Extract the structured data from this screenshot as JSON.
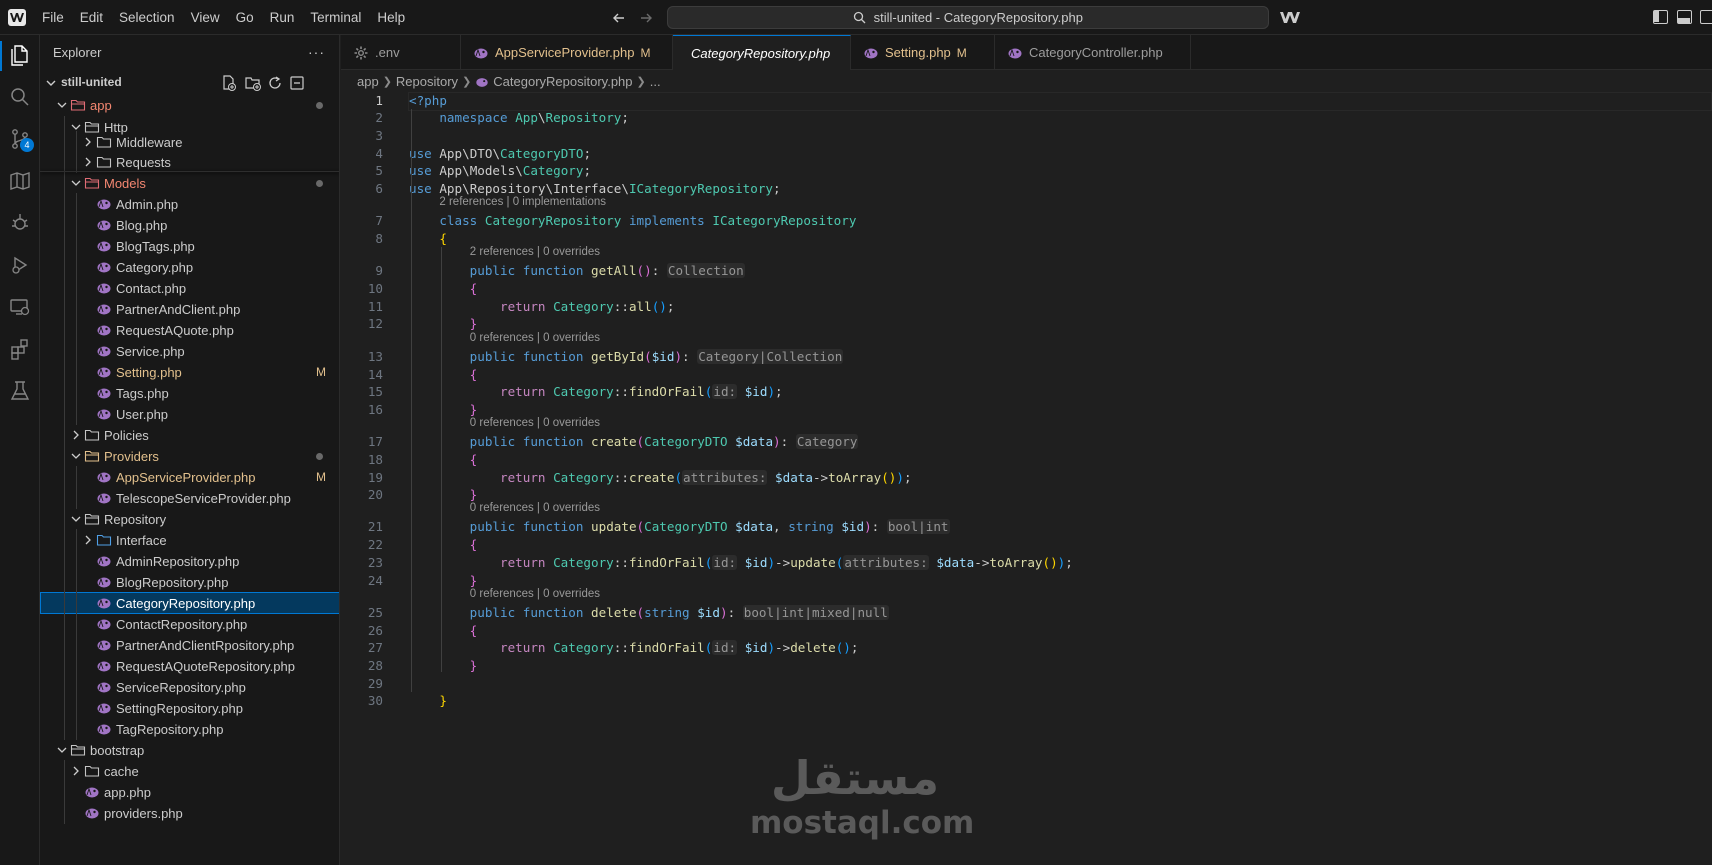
{
  "titlebar": {
    "menu": [
      "File",
      "Edit",
      "Selection",
      "View",
      "Go",
      "Run",
      "Terminal",
      "Help"
    ],
    "command_center": "still-united - CategoryRepository.php"
  },
  "activitybar": {
    "scm_badge": "4",
    "icons": [
      "explorer-icon",
      "search-icon",
      "source-control-icon",
      "map-icon",
      "debug-icon",
      "run-debug-icon",
      "remote-icon",
      "extensions-icon",
      "testing-icon"
    ]
  },
  "sidebar": {
    "title": "Explorer",
    "project": "still-united",
    "tree": [
      {
        "label": "app",
        "kind": "folder-open",
        "depth": 0,
        "state": "err",
        "dot": true
      },
      {
        "label": "Http",
        "kind": "folder-open",
        "depth": 1
      },
      {
        "label": "Middleware",
        "kind": "folder",
        "depth": 2
      },
      {
        "label": "Requests",
        "kind": "folder",
        "depth": 2
      },
      {
        "label": "Models",
        "kind": "folder-open",
        "depth": 1,
        "state": "err",
        "dot": true
      },
      {
        "label": "Admin.php",
        "kind": "php",
        "depth": 2
      },
      {
        "label": "Blog.php",
        "kind": "php",
        "depth": 2
      },
      {
        "label": "BlogTags.php",
        "kind": "php",
        "depth": 2
      },
      {
        "label": "Category.php",
        "kind": "php",
        "depth": 2
      },
      {
        "label": "Contact.php",
        "kind": "php",
        "depth": 2
      },
      {
        "label": "PartnerAndClient.php",
        "kind": "php",
        "depth": 2
      },
      {
        "label": "RequestAQuote.php",
        "kind": "php",
        "depth": 2
      },
      {
        "label": "Service.php",
        "kind": "php",
        "depth": 2
      },
      {
        "label": "Setting.php",
        "kind": "php",
        "depth": 2,
        "state": "mod",
        "badge": "M"
      },
      {
        "label": "Tags.php",
        "kind": "php",
        "depth": 2
      },
      {
        "label": "User.php",
        "kind": "php",
        "depth": 2
      },
      {
        "label": "Policies",
        "kind": "folder",
        "depth": 1
      },
      {
        "label": "Providers",
        "kind": "folder-open",
        "depth": 1,
        "state": "dirty",
        "dot": true
      },
      {
        "label": "AppServiceProvider.php",
        "kind": "php",
        "depth": 2,
        "state": "mod",
        "badge": "M"
      },
      {
        "label": "TelescopeServiceProvider.php",
        "kind": "php",
        "depth": 2
      },
      {
        "label": "Repository",
        "kind": "folder-open",
        "depth": 1
      },
      {
        "label": "Interface",
        "kind": "folder-blue",
        "depth": 2
      },
      {
        "label": "AdminRepository.php",
        "kind": "php",
        "depth": 2
      },
      {
        "label": "BlogRepository.php",
        "kind": "php",
        "depth": 2
      },
      {
        "label": "CategoryRepository.php",
        "kind": "php",
        "depth": 2,
        "selected": true
      },
      {
        "label": "ContactRepository.php",
        "kind": "php",
        "depth": 2
      },
      {
        "label": "PartnerAndClientRpository.php",
        "kind": "php",
        "depth": 2
      },
      {
        "label": "RequestAQuoteRepository.php",
        "kind": "php",
        "depth": 2
      },
      {
        "label": "ServiceRepository.php",
        "kind": "php",
        "depth": 2
      },
      {
        "label": "SettingRepository.php",
        "kind": "php",
        "depth": 2
      },
      {
        "label": "TagRepository.php",
        "kind": "php",
        "depth": 2
      },
      {
        "label": "bootstrap",
        "kind": "folder-open",
        "depth": 0
      },
      {
        "label": "cache",
        "kind": "folder",
        "depth": 1
      },
      {
        "label": "app.php",
        "kind": "php",
        "depth": 1
      },
      {
        "label": "providers.php",
        "kind": "php",
        "depth": 1
      }
    ]
  },
  "tabs": [
    {
      "label": ".env",
      "icon": "gear-icon"
    },
    {
      "label": "AppServiceProvider.php",
      "icon": "php-icon",
      "modified": "M"
    },
    {
      "label": "CategoryRepository.php",
      "icon": "php-icon",
      "active": true
    },
    {
      "label": "Setting.php",
      "icon": "php-icon",
      "modified": "M"
    },
    {
      "label": "CategoryController.php",
      "icon": "php-icon"
    }
  ],
  "breadcrumb": [
    "app",
    "Repository",
    "CategoryRepository.php",
    "..."
  ],
  "code_lens": {
    "class": "2 references | 0 implementations",
    "getAll": "2 references | 0 overrides",
    "getById": "0 references | 0 overrides",
    "create": "0 references | 0 overrides",
    "update": "0 references | 0 overrides",
    "delete": "0 references | 0 overrides"
  },
  "code": {
    "line_numbers": [
      "1",
      "2",
      "3",
      "4",
      "5",
      "6",
      "7",
      "8",
      "9",
      "10",
      "11",
      "12",
      "13",
      "14",
      "15",
      "16",
      "17",
      "18",
      "19",
      "20",
      "21",
      "22",
      "23",
      "24",
      "25",
      "26",
      "27",
      "28",
      "29",
      "30"
    ],
    "t": {
      "php_open": "<?php",
      "namespace": "namespace",
      "ns_app": "App",
      "ns_repo": "Repository",
      "use": "use",
      "ns_dto": "DTO",
      "category_dto": "CategoryDTO",
      "ns_models": "Models",
      "category": "Category",
      "ns_interface": "Interface",
      "icategory_repo": "ICategoryRepository",
      "class": "class",
      "category_repo": "CategoryRepository",
      "implements": "implements",
      "public": "public",
      "function": "function",
      "getAll": "getAll",
      "collection": "Collection",
      "return": "return",
      "all": "all",
      "getById": "getById",
      "var_id": "$id",
      "cat_or_coll": "Category|Collection",
      "findOrFail": "findOrFail",
      "hint_id": "id:",
      "create": "create",
      "var_data": "$data",
      "hint_attributes": "attributes:",
      "toArray": "toArray",
      "update": "update",
      "string": "string",
      "bool_int": "bool|int",
      "delete": "delete",
      "bool_int_mixed_null": "bool|int|mixed|null"
    }
  },
  "watermark": {
    "arabic": "مستقل",
    "latin": "mostaql.com"
  }
}
